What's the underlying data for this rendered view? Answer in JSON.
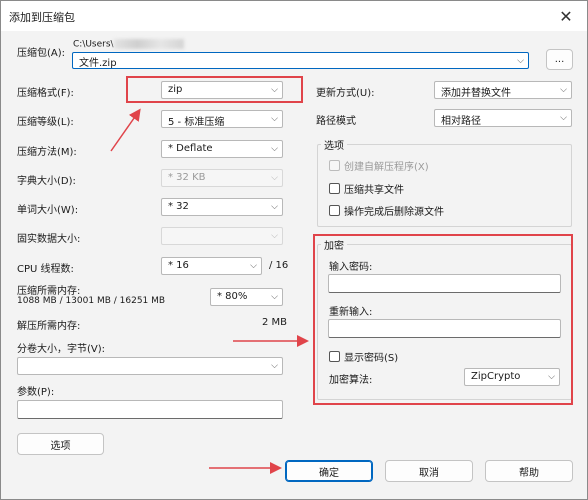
{
  "window": {
    "title": "添加到压缩包",
    "close_icon": "close-icon"
  },
  "archive": {
    "label": "压缩包(A):",
    "path_prefix": "C:\\Users\\",
    "filename": "文件.zip",
    "browse_label": "..."
  },
  "left": {
    "format": {
      "label": "压缩格式(F):",
      "value": "zip"
    },
    "level": {
      "label": "压缩等级(L):",
      "value": "5 - 标准压缩"
    },
    "method": {
      "label": "压缩方法(M):",
      "value": "* Deflate"
    },
    "dict": {
      "label": "字典大小(D):",
      "value": "* 32 KB"
    },
    "word": {
      "label": "单词大小(W):",
      "value": "* 32"
    },
    "solid": {
      "label": "固实数据大小:",
      "value": ""
    },
    "cpu": {
      "label": "CPU 线程数:",
      "value": "* 16",
      "total": "/ 16"
    },
    "mem_compress": {
      "label": "压缩所需内存:",
      "detail": "1088 MB / 13001 MB / 16251 MB",
      "value": "* 80%"
    },
    "mem_decompress": {
      "label": "解压所需内存:",
      "value": "2 MB"
    },
    "split": {
      "label": "分卷大小，字节(V):",
      "value": ""
    },
    "params": {
      "label": "参数(P):",
      "value": ""
    },
    "options_button": "选项"
  },
  "right": {
    "update": {
      "label": "更新方式(U):",
      "value": "添加并替换文件"
    },
    "pathmode": {
      "label": "路径模式",
      "value": "相对路径"
    },
    "options_group": {
      "title": "选项",
      "sfx": "创建自解压程序(X)",
      "shared": "压缩共享文件",
      "delete": "操作完成后删除源文件"
    },
    "encrypt_group": {
      "title": "加密",
      "pwd_label": "输入密码:",
      "repeat_label": "重新输入:",
      "show_pwd": "显示密码(S)",
      "method_label": "加密算法:",
      "method_value": "ZipCrypto"
    }
  },
  "footer": {
    "ok": "确定",
    "cancel": "取消",
    "help": "帮助"
  },
  "colors": {
    "highlight": "#e0444a",
    "accent": "#0067c0"
  }
}
